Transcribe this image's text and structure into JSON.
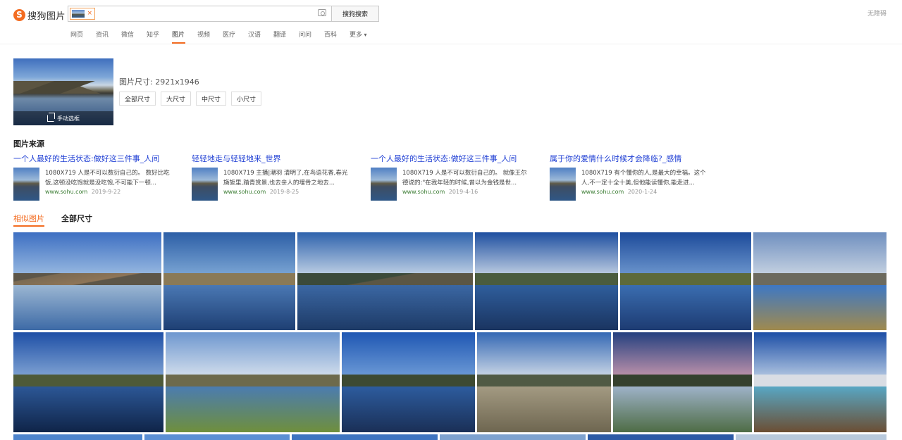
{
  "header": {
    "logo_text": "搜狗图片",
    "search_button": "搜狗搜索",
    "chip_close": "×",
    "accessibility": "无障碍"
  },
  "nav": [
    "网页",
    "资讯",
    "微信",
    "知乎",
    "图片",
    "视频",
    "医疗",
    "汉语",
    "翻译",
    "问问",
    "百科",
    "更多"
  ],
  "nav_active": "图片",
  "query": {
    "crop_label": "手动选框",
    "size_label": "图片尺寸:",
    "size_value": "2921x1946",
    "size_buttons": [
      "全部尺寸",
      "大尺寸",
      "中尺寸",
      "小尺寸"
    ]
  },
  "sources": {
    "title": "图片来源",
    "items": [
      {
        "title": "一个人最好的生活状态:做好这三件事_人间",
        "desc": "1080X719 人是不可以数衍自己的。 数好比吃饭,这顿没吃饱就是没吃饱,不可能下一顿...",
        "site": "www.sohu.com",
        "date": "2019-9-22"
      },
      {
        "title": "轻轻地走与轻轻地来_世界",
        "desc": "1080X719 主播|潮羽 清明了,在鸟语花香,春光旖旎里,踏青赏景,也去亲人的埋骨之地去...",
        "site": "www.sohu.com",
        "date": "2019-8-25"
      },
      {
        "title": "一个人最好的生活状态:做好这三件事_人间",
        "desc": "1080X719 人是不可以数衍自己的。 就像王尔德说的:\"在我年轻的时候,曾以为金钱是世...",
        "site": "www.sohu.com",
        "date": "2019-4-16"
      },
      {
        "title": "属于你的爱情什么时候才会降临?_感情",
        "desc": "1080X719 有个懂你的人,是最大的幸福。这个人,不一定十全十美,但他能读懂你,能走进...",
        "site": "www.sohu.com",
        "date": "2020-1-24"
      }
    ]
  },
  "tabs": [
    "相似图片",
    "全部尺寸"
  ],
  "tab_active": "相似图片",
  "colors": {
    "accent": "#f36c21",
    "link": "#1f3fd4",
    "site_green": "#3a7c32"
  }
}
